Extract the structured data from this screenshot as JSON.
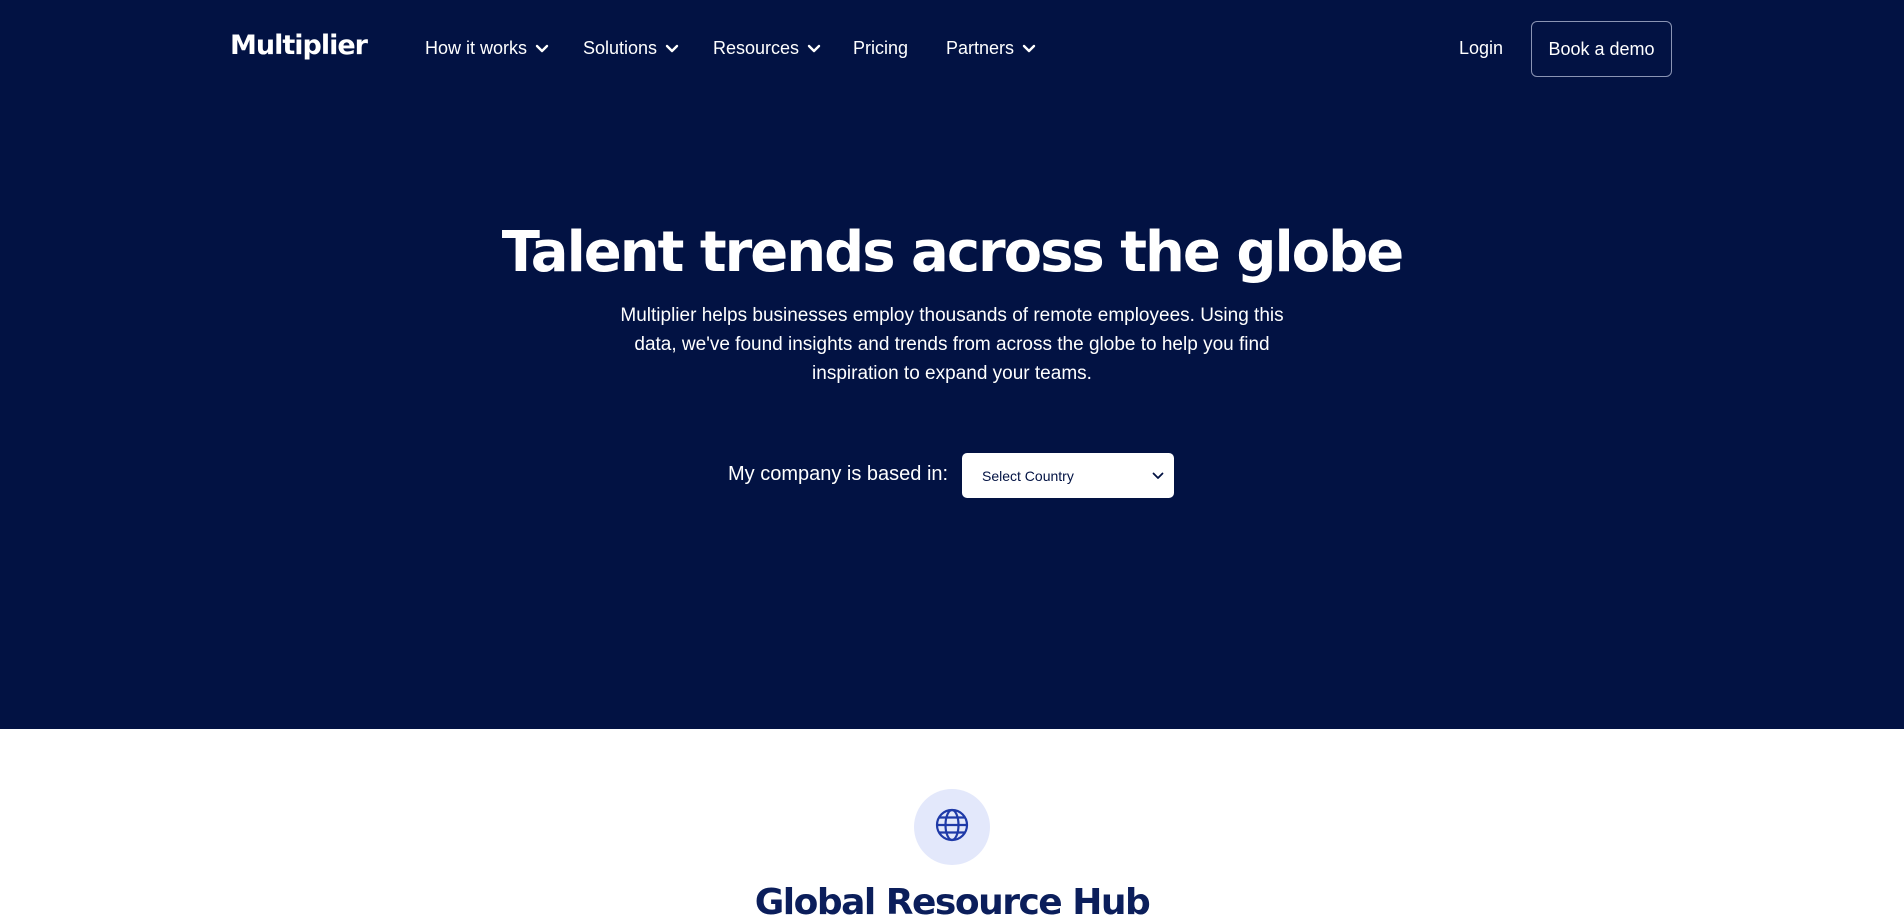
{
  "brand": {
    "logo_text": "Multiplier"
  },
  "nav": {
    "items": [
      {
        "label": "How it works",
        "has_dropdown": true
      },
      {
        "label": "Solutions",
        "has_dropdown": true
      },
      {
        "label": "Resources",
        "has_dropdown": true
      },
      {
        "label": "Pricing",
        "has_dropdown": false
      },
      {
        "label": "Partners",
        "has_dropdown": true
      }
    ],
    "login_label": "Login",
    "demo_label": "Book a demo"
  },
  "hero": {
    "title": "Talent trends across the globe",
    "description": "Multiplier helps businesses employ thousands of remote employees. Using this data, we've found insights and trends from across the globe to help you find inspiration to expand your teams.",
    "based_label": "My company is based in:",
    "country_select": {
      "value": "Select Country"
    }
  },
  "hub": {
    "icon": "globe-icon",
    "title": "Global Resource Hub"
  },
  "colors": {
    "hero_bg": "#021243",
    "hub_icon_bg": "#e3e8fb",
    "hub_title": "#0b1e5b",
    "accent": "#1f3aa8"
  }
}
